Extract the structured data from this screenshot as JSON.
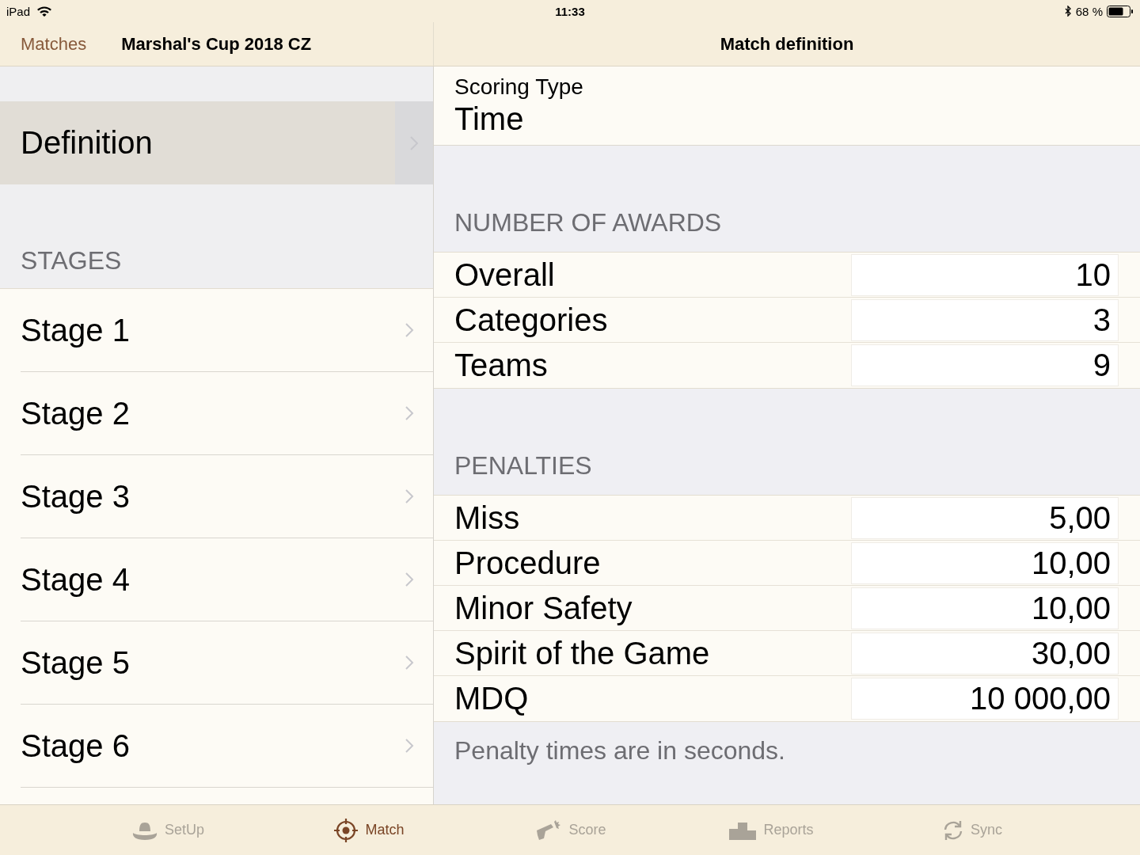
{
  "status_bar": {
    "device": "iPad",
    "time": "11:33",
    "battery": "68 %"
  },
  "master": {
    "back": "Matches",
    "title": "Marshal's Cup 2018 CZ",
    "items": [
      {
        "label": "Definition",
        "selected": true
      }
    ],
    "section": "STAGES",
    "stages": [
      {
        "label": "Stage 1",
        "selected": false
      },
      {
        "label": "Stage 2",
        "selected": false
      },
      {
        "label": "Stage 3",
        "selected": false
      },
      {
        "label": "Stage 4",
        "selected": false
      },
      {
        "label": "Stage 5",
        "selected": false
      },
      {
        "label": "Stage 6",
        "selected": false
      }
    ]
  },
  "detail": {
    "title": "Match definition",
    "scoring": {
      "label": "Scoring Type",
      "value": "Time"
    },
    "sections": [
      {
        "header": "NUMBER OF AWARDS",
        "rows": [
          {
            "label": "Overall",
            "value": "10"
          },
          {
            "label": "Categories",
            "value": "3"
          },
          {
            "label": "Teams",
            "value": "9"
          }
        ]
      },
      {
        "header": "PENALTIES",
        "rows": [
          {
            "label": "Miss",
            "value": "5,00"
          },
          {
            "label": "Procedure",
            "value": "10,00"
          },
          {
            "label": "Minor Safety",
            "value": "10,00"
          },
          {
            "label": "Spirit of the Game",
            "value": "30,00"
          },
          {
            "label": "MDQ",
            "value": "10 000,00"
          }
        ],
        "footer": "Penalty times are in seconds."
      }
    ]
  },
  "tab_bar": [
    {
      "label": "SetUp",
      "kind": "hat",
      "selected": false
    },
    {
      "label": "Match",
      "kind": "target",
      "selected": true
    },
    {
      "label": "Score",
      "kind": "gun",
      "selected": false
    },
    {
      "label": "Reports",
      "kind": "podium",
      "selected": false
    },
    {
      "label": "Sync",
      "kind": "sync",
      "selected": false
    }
  ]
}
